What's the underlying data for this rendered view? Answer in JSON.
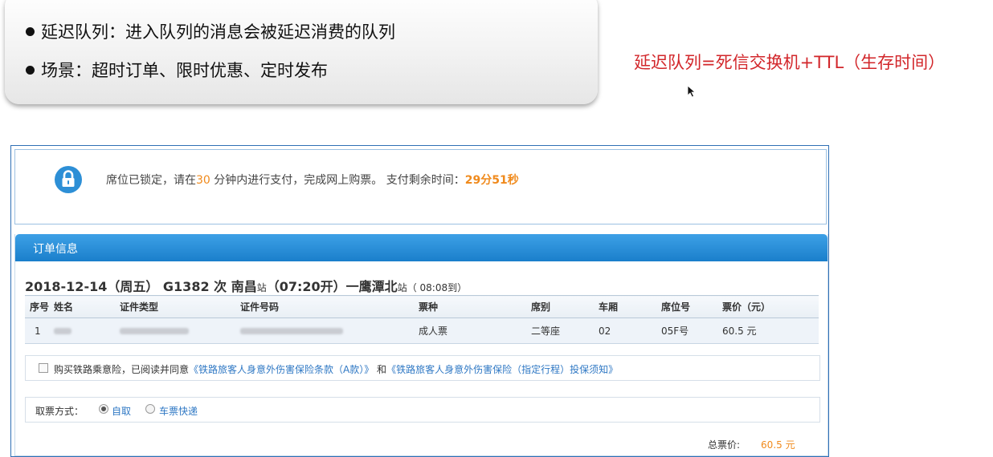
{
  "slide": {
    "bullet1": "延迟队列：进入队列的消息会被延迟消费的队列",
    "bullet2": "场景：超时订单、限时优惠、定时发布"
  },
  "formula": "延迟队列=死信交换机+TTL（生存时间）",
  "lock_notice": {
    "prefix": "席位已锁定，请在",
    "minutes": "30",
    "middle": " 分钟内进行支付，完成网上购票。 支付剩余时间：",
    "remaining": "29分51秒"
  },
  "order": {
    "header": "订单信息",
    "trip_main": "2018-12-14（周五） G1382 次  南昌",
    "station_suffix": "站",
    "dep_time": "（07:20开）一鹰潭北",
    "arr_suffix": "站",
    "arr_time": "（ 08:08到）",
    "columns": [
      "序号",
      "姓名",
      "证件类型",
      "证件号码",
      "票种",
      "席别",
      "车厢",
      "席位号",
      "票价（元）"
    ],
    "row": {
      "seq": "1",
      "ticket_type": "成人票",
      "seat_class": "二等座",
      "car": "02",
      "seat_no": "05F号",
      "price": "60.5 元"
    }
  },
  "insurance": {
    "text": "购买铁路乘意险，已阅读并同意",
    "link1": "《铁路旅客人身意外伤害保险条款（A款）》",
    "and": " 和",
    "link2": "《铁路旅客人身意外伤害保险（指定行程）投保须知》"
  },
  "ticket_pickup": {
    "label": "取票方式：",
    "option1": "自取",
    "option2": "车票快递",
    "selected": "自取"
  },
  "total": {
    "label": "总票价:",
    "value": "60.5 元"
  },
  "colors": {
    "formula_red": "#d2262a",
    "accent_orange": "#f08a1c",
    "header_blue": "#1a7fcb",
    "link_blue": "#2f78c4"
  }
}
